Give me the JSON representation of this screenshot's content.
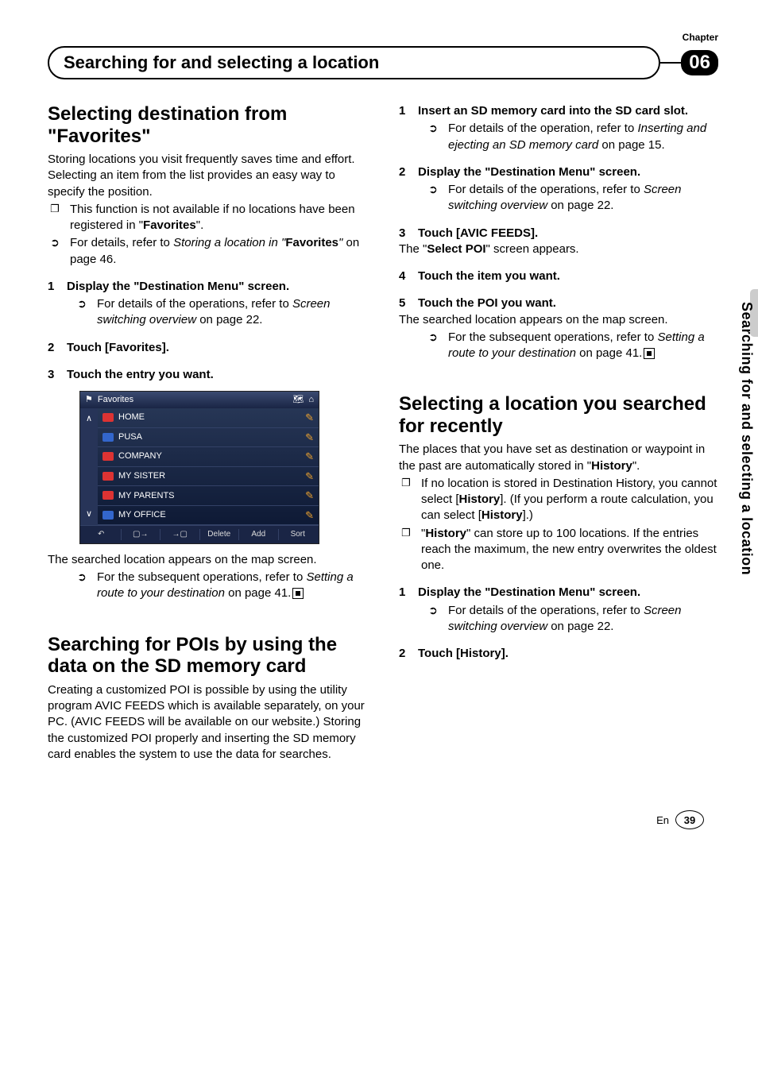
{
  "meta": {
    "chapter_label": "Chapter",
    "chapter_num": "06",
    "header_title": "Searching for and selecting a location",
    "side_title": "Searching for and selecting a location",
    "lang": "En",
    "page": "39"
  },
  "left": {
    "h1": "Selecting destination from \"Favorites\"",
    "p1": "Storing locations you visit frequently saves time and effort.",
    "p2": "Selecting an item from the list provides an easy way to specify the position.",
    "b1": "This function is not available if no locations have been registered in \"",
    "b1b": "Favorites",
    "b1c": "\".",
    "b2a": "For details, refer to ",
    "b2i": "Storing a location in \"",
    "b2b": "Favorites",
    "b2i2": "\"",
    "b2c": " on page 46.",
    "s1": "Display the \"Destination Menu\" screen.",
    "s1ref_a": "For details of the operations, refer to ",
    "s1ref_i": "Screen switching overview",
    "s1ref_b": " on page 22.",
    "s2": "Touch [Favorites].",
    "s3": "Touch the entry you want.",
    "cap1": "The searched location appears on the map screen.",
    "ref2a": "For the subsequent operations, refer to ",
    "ref2i": "Setting a route to your destination",
    "ref2b": " on page 41.",
    "h2": "Searching for POIs by using the data on the SD memory card",
    "p3": "Creating a customized POI is possible by using the utility program AVIC FEEDS which is available separately, on your PC. (AVIC FEEDS will be available on our website.) Storing the customized POI properly and inserting the SD memory card enables the system to use the data for searches."
  },
  "right": {
    "s1": "Insert an SD memory card into the SD card slot.",
    "s1ref_a": "For details of the operation, refer to ",
    "s1ref_i": "Inserting and ejecting an SD memory card",
    "s1ref_b": " on page 15.",
    "s2": "Display the \"Destination Menu\" screen.",
    "s2ref_a": "For details of the operations, refer to ",
    "s2ref_i": "Screen switching overview",
    "s2ref_b": " on page 22.",
    "s3": "Touch [AVIC FEEDS].",
    "s3txt_a": "The \"",
    "s3txt_b": "Select POI",
    "s3txt_c": "\" screen appears.",
    "s4": "Touch the item you want.",
    "s5": "Touch the POI you want.",
    "s5txt": "The searched location appears on the map screen.",
    "s5ref_a": "For the subsequent operations, refer to ",
    "s5ref_i": "Setting a route to your destination",
    "s5ref_b": " on page 41.",
    "h2": "Selecting a location you searched for recently",
    "p1a": "The places that you have set as destination or waypoint in the past are automatically stored in \"",
    "p1b": "History",
    "p1c": "\".",
    "b1a": "If no location is stored in Destination History, you cannot select [",
    "b1b": "History",
    "b1c": "]. (If you perform a route calculation, you can select [",
    "b1d": "History",
    "b1e": "].)",
    "b2a": "\"",
    "b2b": "History",
    "b2c": "\" can store up to 100 locations. If the entries reach the maximum, the new entry overwrites the oldest one.",
    "rs1": "Display the \"Destination Menu\" screen.",
    "rs1ref_a": "For details of the operations, refer to ",
    "rs1ref_i": "Screen switching overview",
    "rs1ref_b": " on page 22.",
    "rs2": "Touch [History]."
  },
  "fav": {
    "title": "Favorites",
    "items": [
      {
        "label": "HOME",
        "color": "#d33"
      },
      {
        "label": "PUSA",
        "color": "#36c"
      },
      {
        "label": "COMPANY",
        "color": "#d33"
      },
      {
        "label": "MY SISTER",
        "color": "#d33"
      },
      {
        "label": "MY PARENTS",
        "color": "#d33"
      },
      {
        "label": "MY OFFICE",
        "color": "#36c"
      }
    ],
    "ftr": [
      "↶",
      "▢→",
      "→▢",
      "Delete",
      "Add",
      "Sort"
    ]
  }
}
